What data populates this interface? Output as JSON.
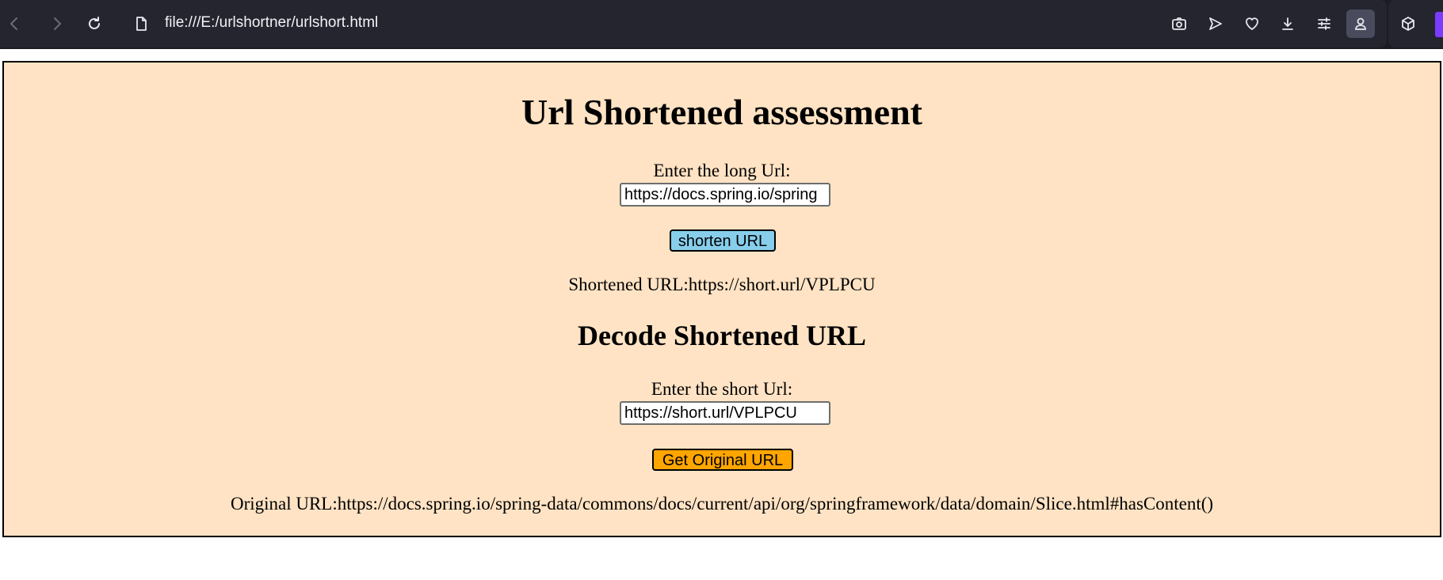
{
  "browser": {
    "url": "file:///E:/urlshortner/urlshort.html",
    "icons": [
      "back-icon",
      "forward-icon",
      "reload-icon",
      "file-icon",
      "camera-icon",
      "send-icon",
      "heart-icon",
      "download-icon",
      "sliders-icon",
      "profile-icon",
      "cube-icon"
    ]
  },
  "page": {
    "title": "Url Shortened assessment",
    "shorten": {
      "label": "Enter the long Url:",
      "input_value": "https://docs.spring.io/spring",
      "button_label": "shorten URL",
      "result_label": "Shortened URL:",
      "result_value": "https://short.url/VPLPCU"
    },
    "decode": {
      "heading": "Decode Shortened URL",
      "label": "Enter the short Url:",
      "input_value": "https://short.url/VPLPCU",
      "button_label": "Get Original URL",
      "result_label": "Original URL:",
      "result_value": "https://docs.spring.io/spring-data/commons/docs/current/api/org/springframework/data/domain/Slice.html#hasContent()"
    }
  },
  "colors": {
    "page_background": "#ffe3c4",
    "shorten_button": "#87ceeb",
    "original_button": "#ffa500",
    "toolbar": "#24252f"
  }
}
